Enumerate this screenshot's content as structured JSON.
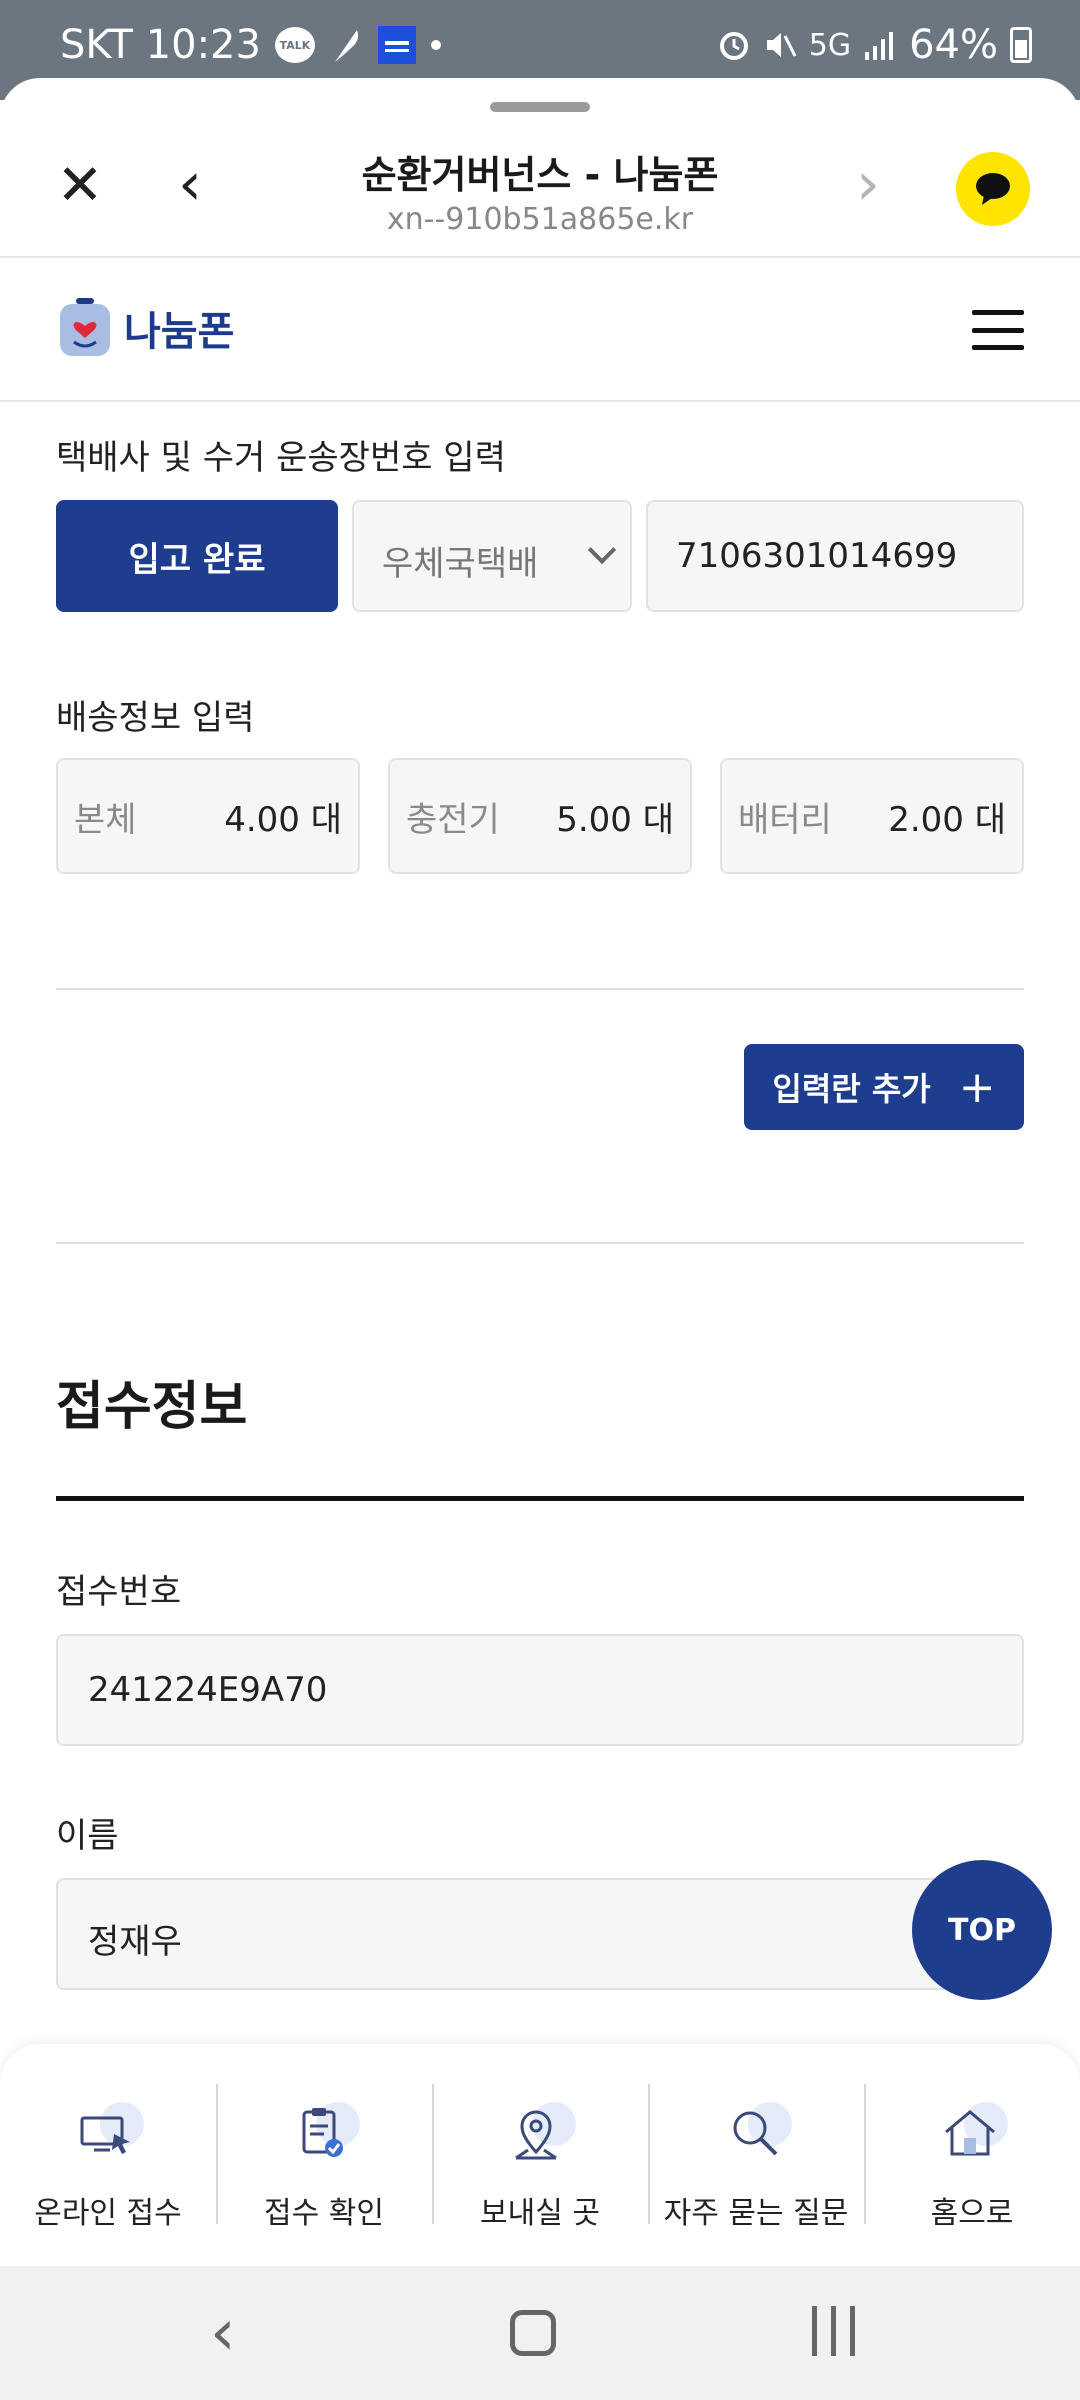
{
  "status_bar": {
    "carrier_time": "SKT 10:23",
    "talk_badge": "TALK",
    "network": "5G",
    "battery": "64%"
  },
  "browser": {
    "title": "순환거버넌스 - 나눔폰",
    "url": "xn--910b51a865e.kr"
  },
  "site": {
    "logo_text": "나눔폰"
  },
  "courier": {
    "label": "택배사 및 수거 운송장번호 입력",
    "button": "입고 완료",
    "carrier": "우체국택배",
    "tracking_number": "7106301014699"
  },
  "delivery": {
    "label": "배송정보 입력",
    "items": [
      {
        "name": "본체",
        "value": "4.00 대"
      },
      {
        "name": "충전기",
        "value": "5.00 대"
      },
      {
        "name": "배터리",
        "value": "2.00 대"
      }
    ]
  },
  "add_field_button": "입력란 추가",
  "add_icon": "+",
  "receipt": {
    "heading": "접수정보",
    "number_label": "접수번호",
    "number_value": "241224E9A70",
    "name_label": "이름",
    "name_value": "정재우"
  },
  "top_button": "TOP",
  "bottom_nav": [
    {
      "label": "온라인 접수",
      "icon": "online-apply-icon"
    },
    {
      "label": "접수 확인",
      "icon": "clipboard-check-icon"
    },
    {
      "label": "보내실 곳",
      "icon": "map-pin-icon"
    },
    {
      "label": "자주 묻는 질문",
      "icon": "search-icon"
    },
    {
      "label": "홈으로",
      "icon": "home-icon"
    }
  ],
  "colors": {
    "navy": "#1f3d8f",
    "kakao_yellow": "#fee500",
    "status_bar": "#6b7680"
  }
}
